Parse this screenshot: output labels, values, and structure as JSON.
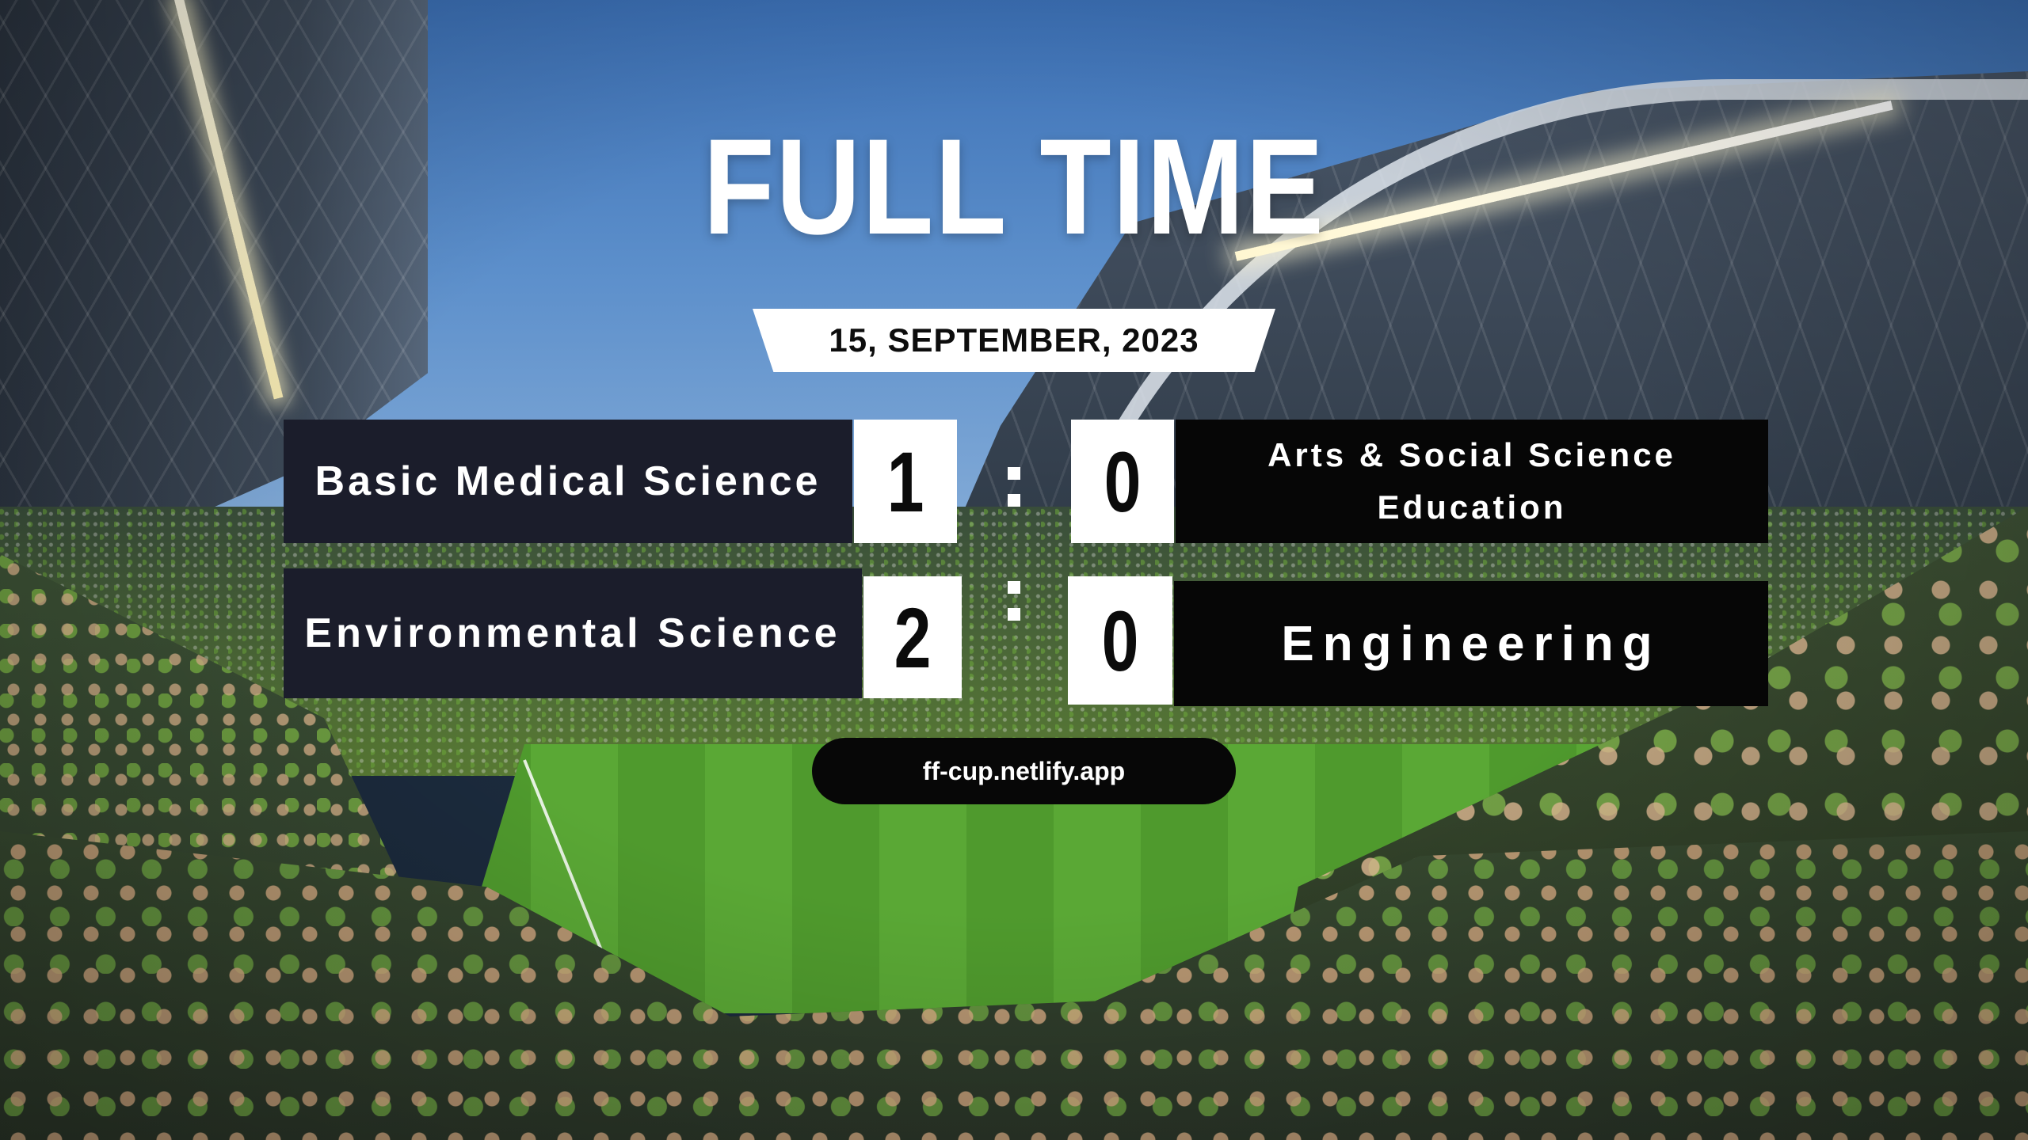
{
  "title": "FULL TIME",
  "date": "15, SEPTEMBER, 2023",
  "matches": [
    {
      "home_team": "Basic Medical Science",
      "home_score": "1",
      "separator": ":",
      "away_score": "0",
      "away_team": "Arts & Social Science Education"
    },
    {
      "home_team": "Environmental Science",
      "home_score": "2",
      "separator": ":",
      "away_score": "0",
      "away_team": "Engineering"
    }
  ],
  "website": "ff-cup.netlify.app",
  "colors": {
    "home_panel": "#1b1d2b",
    "away_panel": "#060606",
    "score_box": "#ffffff",
    "title_text": "#ffffff"
  },
  "background": "stadium-crowd-photo"
}
